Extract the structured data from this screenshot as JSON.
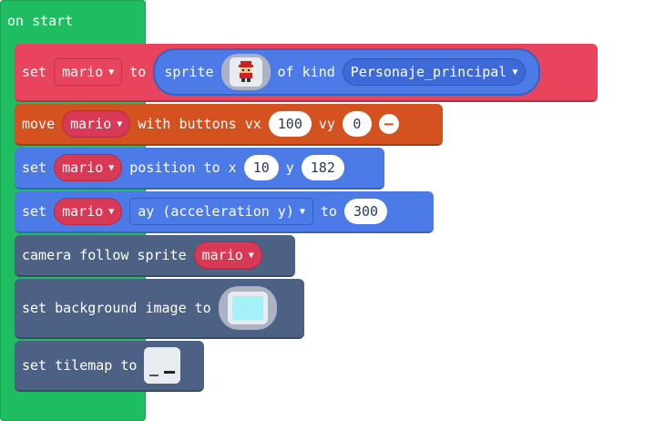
{
  "hat": {
    "label": "on start"
  },
  "block1": {
    "set_label": "set",
    "var": "mario",
    "to_label": "to",
    "sprite_label": "sprite",
    "of_kind_label": "of kind",
    "kind": "Personaje_principal"
  },
  "block2": {
    "move_label": "move",
    "var": "mario",
    "with_buttons_label": "with buttons vx",
    "vx": "100",
    "vy_label": "vy",
    "vy": "0"
  },
  "block3": {
    "set_label": "set",
    "var": "mario",
    "position_label": "position to x",
    "x": "10",
    "y_label": "y",
    "y": "182"
  },
  "block4": {
    "set_label": "set",
    "var": "mario",
    "property": "ay (acceleration y)",
    "to_label": "to",
    "value": "300"
  },
  "block5": {
    "label": "camera follow sprite",
    "var": "mario"
  },
  "block6": {
    "label": "set background image to"
  },
  "block7": {
    "label": "set tilemap to"
  },
  "colors": {
    "loops_green": "#1fbd61",
    "sprites_red": "#e8445e",
    "controller_orange": "#d35220",
    "blue": "#4c7be8",
    "scene_slate": "#4c6184",
    "background_preview": "#a4f1f7"
  },
  "icons": {
    "caret": "▼",
    "minus": "−"
  }
}
